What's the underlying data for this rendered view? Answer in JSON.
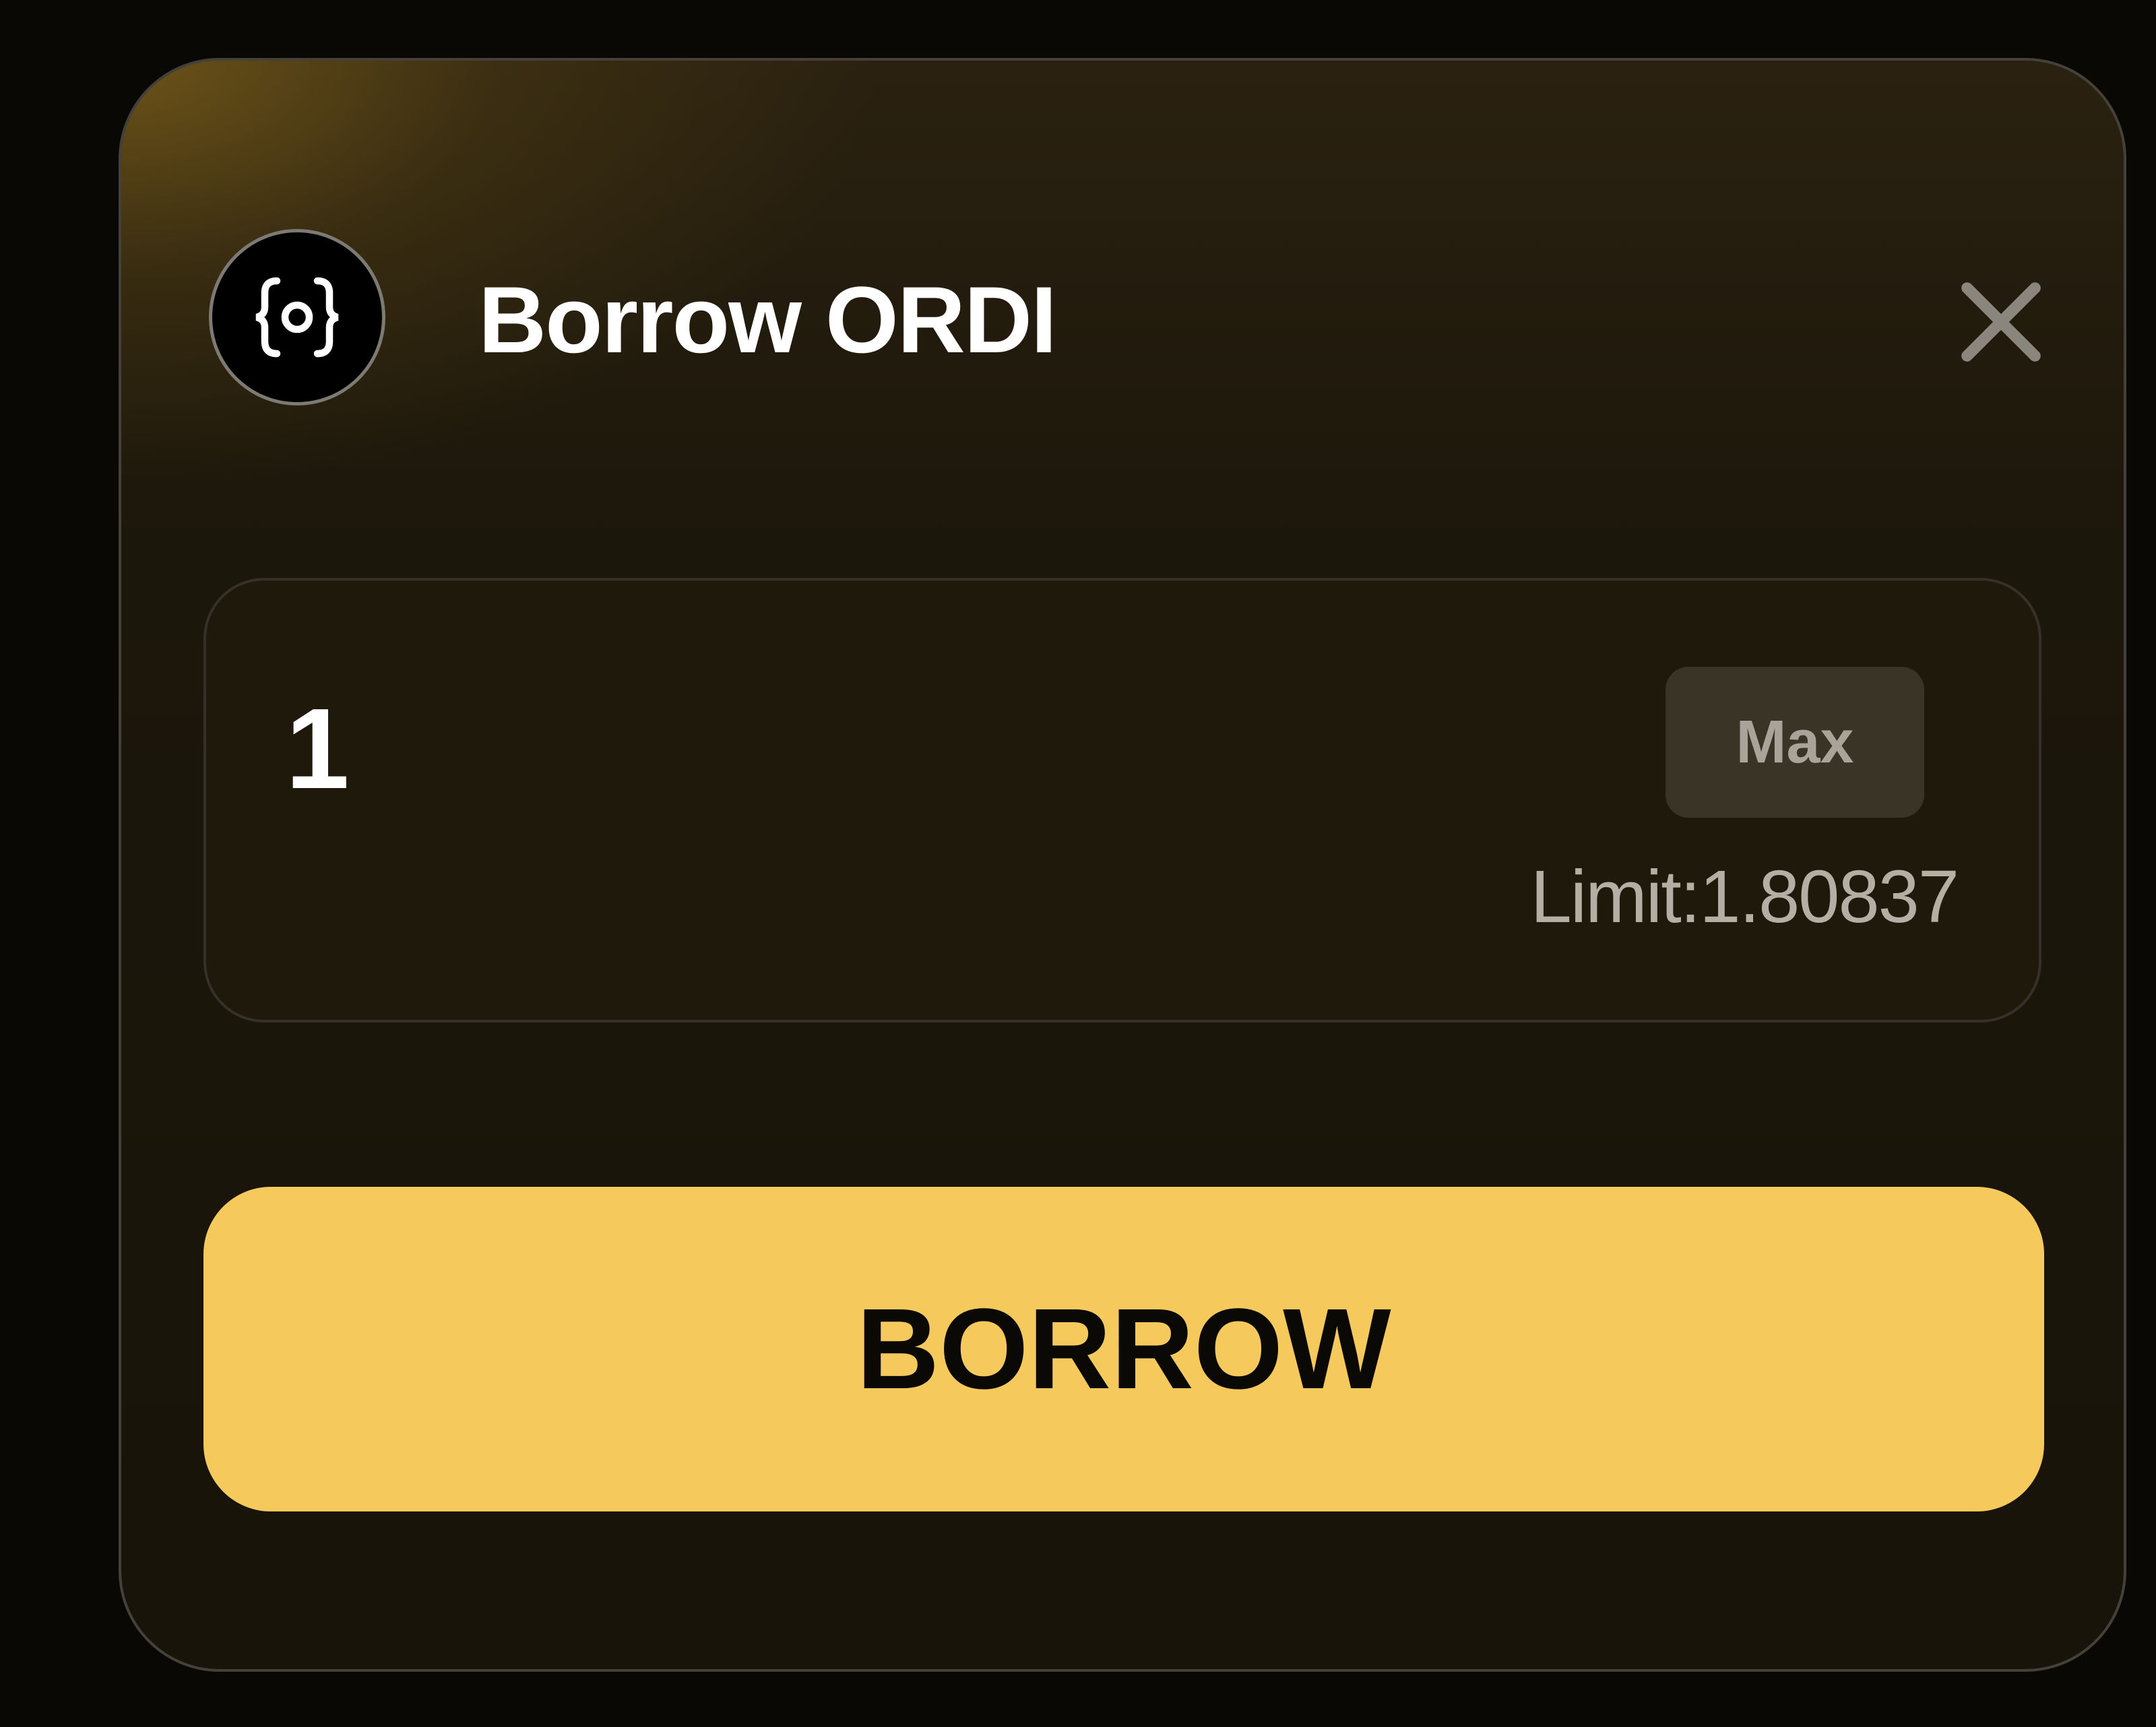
{
  "modal": {
    "title": "Borrow ORDI",
    "token_icon": "ordi-token-icon",
    "close_icon": "close-icon"
  },
  "amount": {
    "value": "1",
    "max_label": "Max",
    "limit_text": "Limit:1.80837"
  },
  "actions": {
    "borrow_label": "BORROW"
  },
  "colors": {
    "accent": "#f6c95d",
    "background": "#18140a",
    "text": "#ffffff",
    "muted": "#b4aea4"
  }
}
